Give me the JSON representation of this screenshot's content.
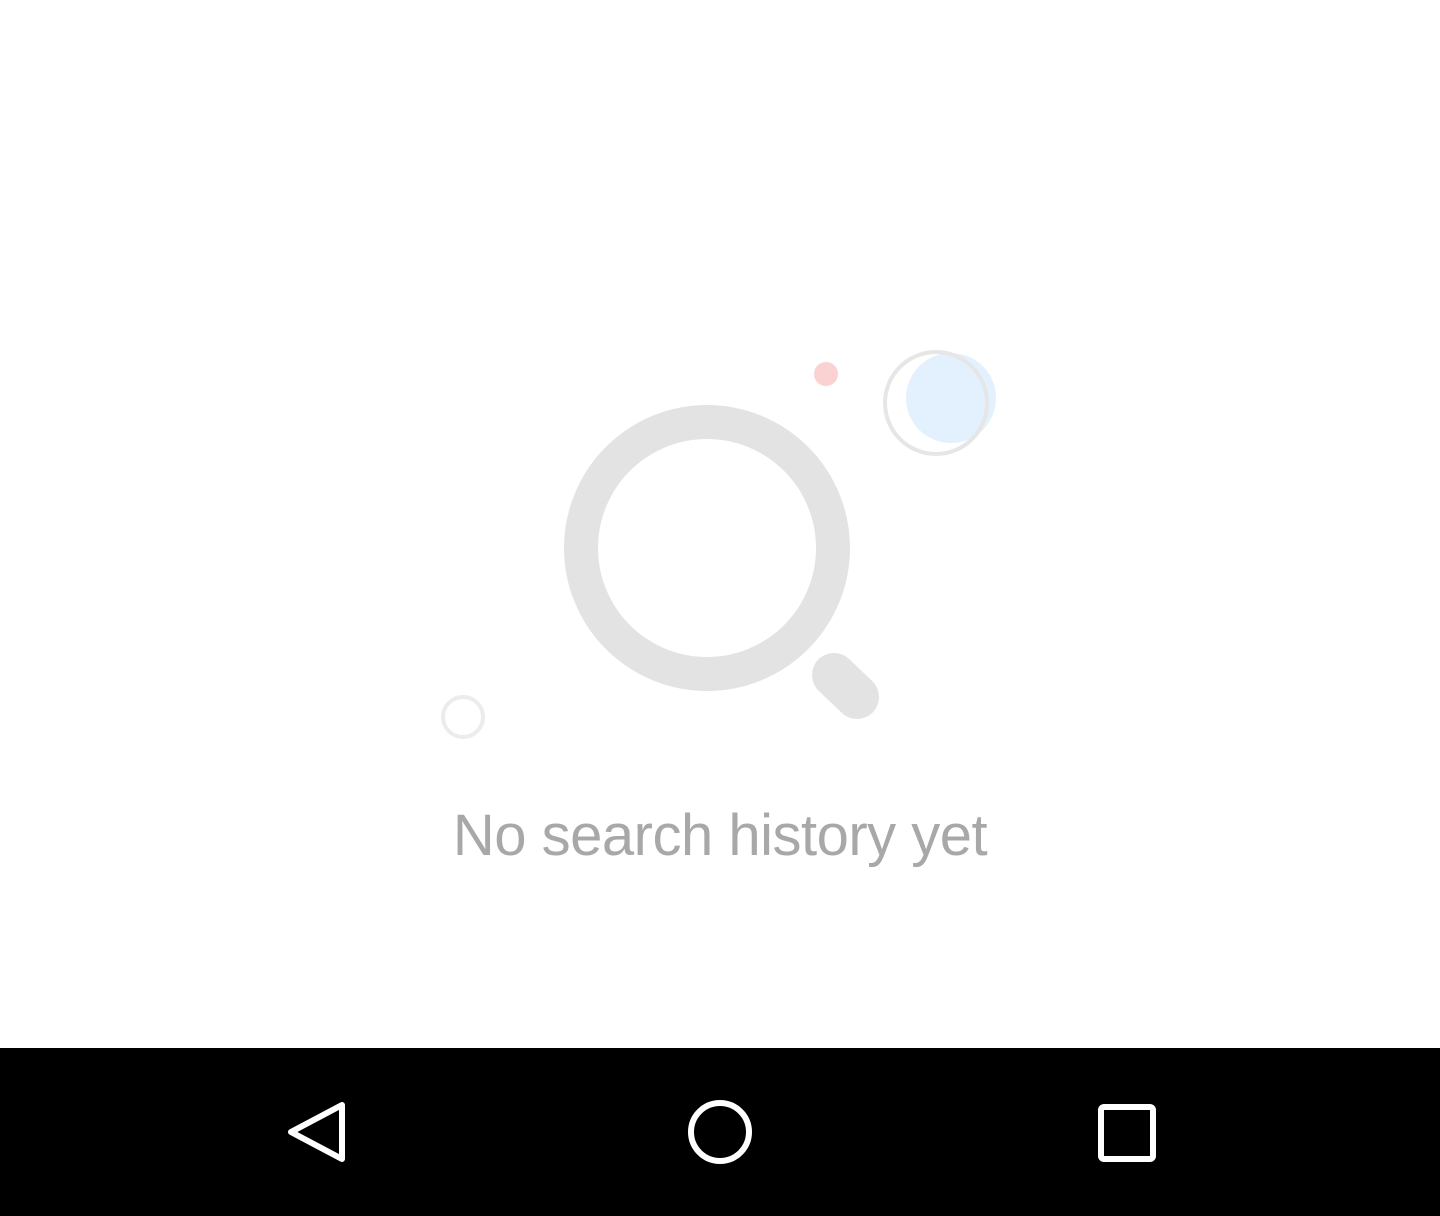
{
  "empty_state": {
    "message": "No search history yet",
    "illustration_icon": "search-icon",
    "colors": {
      "magnifier": "#e3e3e3",
      "message_text": "#a8a8a8",
      "accent_dot": "#fbd2d2",
      "bubble_fill": "#e2f1fd",
      "bubble_outline": "#e6e6e6"
    }
  },
  "navigation_bar": {
    "background": "#000000",
    "icon_color": "#ffffff",
    "buttons": [
      {
        "icon": "back-triangle-icon"
      },
      {
        "icon": "home-circle-icon"
      },
      {
        "icon": "recents-square-icon"
      }
    ]
  }
}
